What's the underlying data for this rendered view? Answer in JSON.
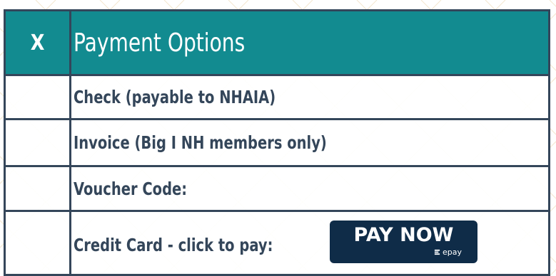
{
  "header": {
    "x_mark": "X",
    "title": "Payment Options"
  },
  "options": [
    {
      "label": "Check (payable to NHAIA)"
    },
    {
      "label": "Invoice (Big I NH members only)"
    },
    {
      "label": "Voucher Code:"
    },
    {
      "label": "Credit Card - click to pay:"
    }
  ],
  "pay_button": {
    "label": "PAY NOW",
    "brand": "epay"
  },
  "colors": {
    "header_bg": "#128b90",
    "border": "#34465a",
    "text": "#34465a",
    "button_bg": "#0f2c48"
  }
}
